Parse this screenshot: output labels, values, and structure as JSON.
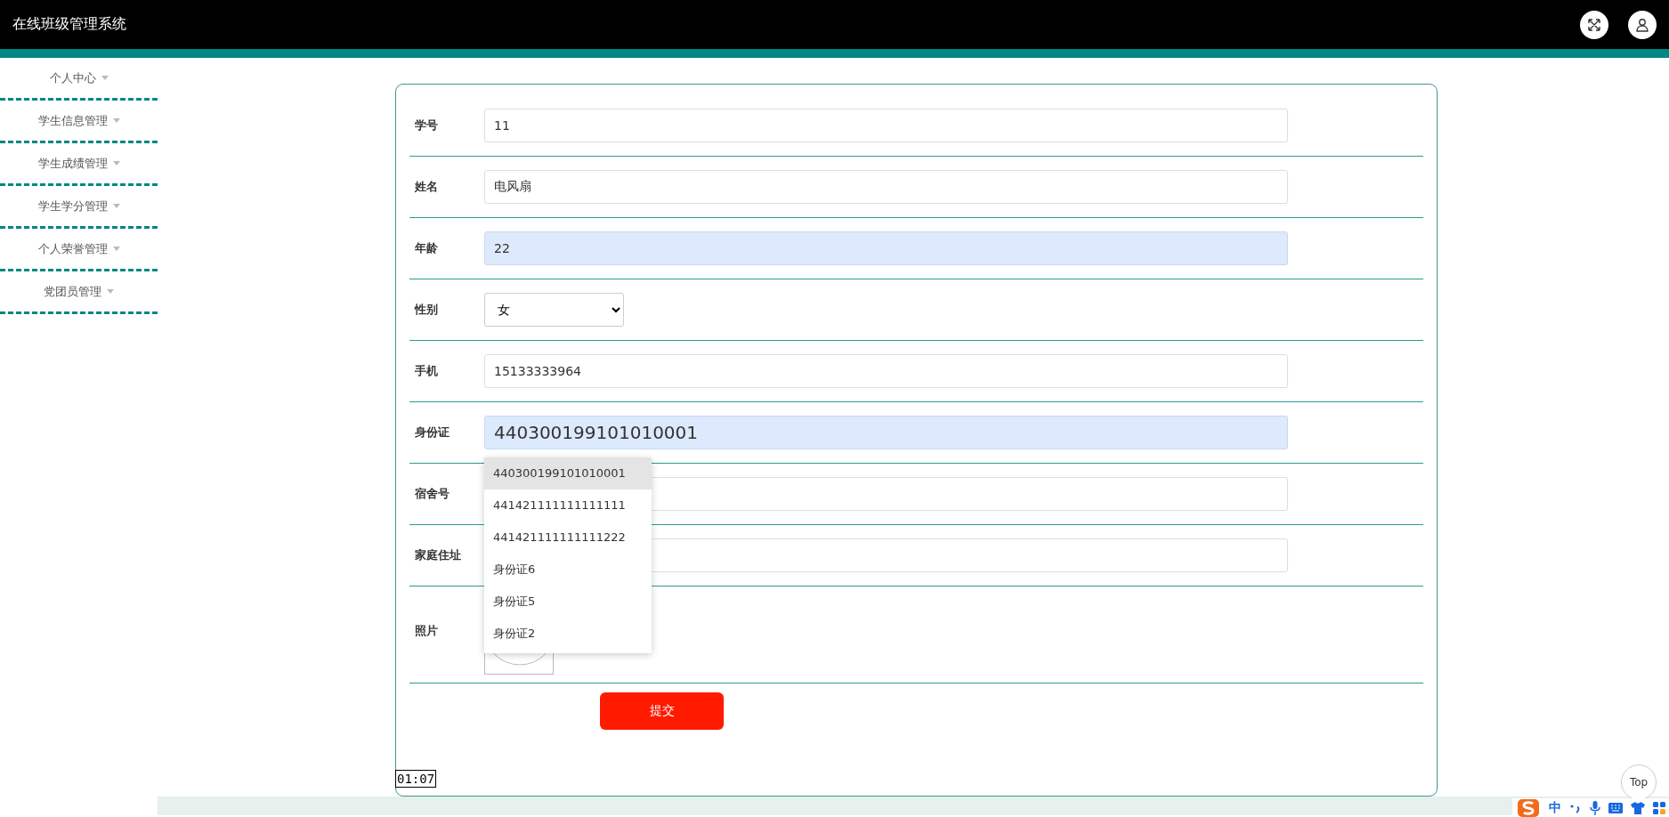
{
  "header": {
    "title": "在线班级管理系统"
  },
  "sidebar": {
    "items": [
      {
        "label": "个人中心",
        "expanded": false
      },
      {
        "label": "学生信息管理",
        "expanded": false
      },
      {
        "label": "学生成绩管理",
        "expanded": false
      },
      {
        "label": "学生学分管理",
        "expanded": false
      },
      {
        "label": "个人荣誉管理",
        "expanded": false
      },
      {
        "label": "党团员管理",
        "expanded": false
      }
    ]
  },
  "form": {
    "fields": [
      {
        "kind": "text",
        "label": "学号",
        "value": "11",
        "autofilled": false
      },
      {
        "kind": "text",
        "label": "姓名",
        "value": "电风扇",
        "autofilled": false
      },
      {
        "kind": "text",
        "label": "年龄",
        "value": "22",
        "autofilled": true
      },
      {
        "kind": "select",
        "label": "性别",
        "value": "女",
        "autofilled": false
      },
      {
        "kind": "text",
        "label": "手机",
        "value": "15133333964",
        "autofilled": false
      },
      {
        "kind": "text",
        "label": "身份证",
        "value": "440300199101010001",
        "autofilled": true,
        "large": true,
        "suggestions": [
          {
            "text": "440300199101010001",
            "selected": true
          },
          {
            "text": "441421111111111111",
            "selected": false
          },
          {
            "text": "441421111111111222",
            "selected": false
          },
          {
            "text": "身份证6",
            "selected": false
          },
          {
            "text": "身份证5",
            "selected": false
          },
          {
            "text": "身份证2",
            "selected": false
          }
        ]
      },
      {
        "kind": "text",
        "label": "宿舍号",
        "autofilled": false
      },
      {
        "kind": "text",
        "label": "家庭住址",
        "autofilled": false
      },
      {
        "kind": "photo",
        "label": "照片"
      }
    ],
    "submit": "提交"
  },
  "timer": "01:07",
  "back_to_top": "Top",
  "ime_toolbar": {
    "mode": "中"
  }
}
